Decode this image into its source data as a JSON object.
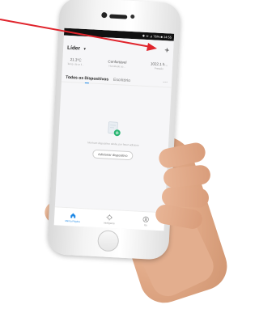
{
  "status_bar": {
    "text": "✱ ᯤ ⊿ 76% ■ 14:55"
  },
  "header": {
    "home_name": "Líder",
    "caret": "▾",
    "plus": "+"
  },
  "weather": [
    {
      "value": "21.3°C",
      "label": "Temp. de ar li..."
    },
    {
      "value": "Confortável",
      "label": "Humidade ao..."
    },
    {
      "value": "1022.1 h...",
      "label": "Pressão"
    }
  ],
  "tabs": {
    "active": "Todos os Dispositivos",
    "other": "Escritório",
    "more": "···"
  },
  "empty": {
    "message": "Nenhum dispositivo ainda, por favor adicione",
    "add_button": "Adicionar dispositivo"
  },
  "nav": [
    {
      "label": "Minha Página",
      "icon": "home-icon",
      "active": true
    },
    {
      "label": "Inteligente",
      "icon": "smart-icon",
      "active": false
    },
    {
      "label": "Eu",
      "icon": "profile-icon",
      "active": false
    }
  ],
  "colors": {
    "accent": "#1e88e5",
    "annotation_arrow": "#e0242c"
  }
}
